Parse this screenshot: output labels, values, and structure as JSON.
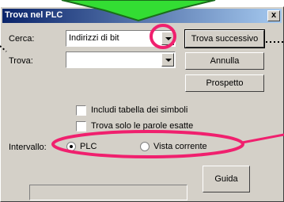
{
  "dialog": {
    "title": "Trova nel PLC",
    "close_glyph": "x"
  },
  "search": {
    "label": "Cerca:",
    "value": "Indirizzi di bit"
  },
  "find": {
    "label": "Trova:",
    "value": ""
  },
  "buttons": {
    "find_next": "Trova successivo",
    "cancel": "Annulla",
    "prospect": "Prospetto",
    "help": "Guida"
  },
  "options": {
    "include_symbols": "Includi tabella dei simboli",
    "whole_word": "Trova solo le parole esatte",
    "whole_word_checked": false,
    "include_symbols_checked": false
  },
  "interval": {
    "label": "Intervallo:",
    "plc": "PLC",
    "current_view": "Vista corrente",
    "selected": "PLC"
  },
  "annotation_colors": {
    "highlight": "#f0206e",
    "arrow": "#33dd33",
    "arrow_border": "#1a6d1a"
  }
}
